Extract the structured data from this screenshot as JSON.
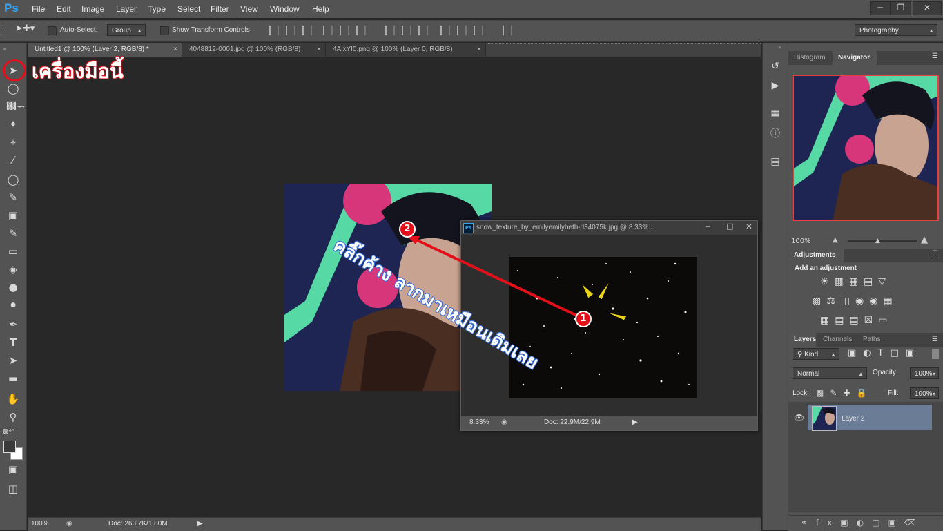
{
  "app": {
    "logo": "Ps"
  },
  "menu": [
    "File",
    "Edit",
    "Image",
    "Layer",
    "Type",
    "Select",
    "Filter",
    "View",
    "Window",
    "Help"
  ],
  "options": {
    "auto_select_label": "Auto-Select:",
    "auto_select_value": "Group",
    "transform_label": "Show Transform Controls",
    "workspace": "Photography"
  },
  "tabs": [
    {
      "label": "Untitled1 @ 100% (Layer 2, RGB/8) *",
      "close": "×"
    },
    {
      "label": "4048812-0001.jpg @ 100% (RGB/8)",
      "close": "×"
    },
    {
      "label": "4AjxYI0.png @ 100% (Layer 0, RGB/8)",
      "close": "×"
    }
  ],
  "status": {
    "zoom": "100%",
    "doc": "Doc: 263.7K/1.80M"
  },
  "float_window": {
    "title": "snow_texture_by_emilyemilybeth-d34075k.jpg @ 8.33%...",
    "zoom": "8.33%",
    "doc": "Doc: 22.9M/22.9M",
    "ps_badge": "Ps"
  },
  "panels": {
    "histogram_tab": "Histogram",
    "navigator_tab": "Navigator",
    "nav_zoom": "100%",
    "adjustments_tab": "Adjustments",
    "add_adjustment": "Add an adjustment",
    "layers_tab": "Layers",
    "channels_tab": "Channels",
    "paths_tab": "Paths",
    "kind": "Kind",
    "blend_mode": "Normal",
    "opacity_label": "Opacity:",
    "opacity_value": "100%",
    "lock_label": "Lock:",
    "fill_label": "Fill:",
    "fill_value": "100%",
    "layer_name": "Layer 2"
  },
  "annotations": {
    "tool_note": "เครื่องมือนี้",
    "drag_note": "คลิ๊กค้าง ลากมาเหมือนเดิมเลย",
    "marker1": "1",
    "marker2": "2"
  },
  "colors": {
    "accent_red": "#e3101a",
    "ui_grey": "#535353",
    "canvas_bg": "#282828",
    "layer_sel": "#6b7d96"
  }
}
